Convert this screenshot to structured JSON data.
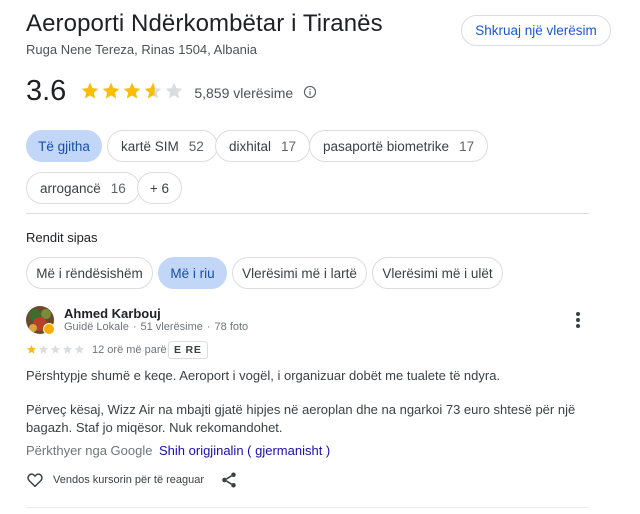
{
  "place": {
    "title": "Aeroporti Ndërkombëtar i Tiranës",
    "address": "Ruga Nene Tereza, Rinas 1504, Albania",
    "write_review_label": "Shkruaj një vlerësim",
    "rating": "3.6",
    "rating_fraction": 0.72,
    "review_count": "5,859 vlerësime"
  },
  "filters": [
    {
      "label": "Të gjitha",
      "count": ""
    },
    {
      "label": "kartë SIM",
      "count": "52"
    },
    {
      "label": "dixhital",
      "count": "17"
    },
    {
      "label": "pasaportë biometrike",
      "count": "17"
    },
    {
      "label": "arrogancë",
      "count": "16"
    },
    {
      "label": "+ 6",
      "count": ""
    }
  ],
  "sort": {
    "label": "Rendit sipas",
    "options": [
      "Më i rëndësishëm",
      "Më i riu",
      "Vlerësimi më i lartë",
      "Vlerësimi më i ulët"
    ],
    "selected": "Më i riu"
  },
  "review": {
    "author": "Ahmed Karbouj",
    "level": "Guidë Lokale",
    "reviews": "51 vlerësime",
    "photos": "78 foto",
    "stars": 1,
    "time": "12 orë më parë",
    "badge": "E RE",
    "paragraph1": "Përshtypje shumë e keqe. Aeroport i vogël, i organizuar dobët me tualete të ndyra.",
    "paragraph2": "Përveç kësaj, Wizz Air na mbajti gjatë hipjes në aeroplan dhe na ngarkoi 73 euro shtesë për një bagazh. Staf jo miqësor. Nuk rekomandohet.",
    "translated_label": "Përkthyer nga Google",
    "see_original": "Shih origjinalin ( gjermanisht )",
    "react_label": "Vendos kursorin për të reaguar"
  },
  "colors": {
    "star_gold": "#fbbc04",
    "star_empty": "#dadce0",
    "active_chip": "#c2d7f8",
    "link": "#1a0dab"
  },
  "icons": [
    "star-icon",
    "info-icon",
    "more-vert-icon",
    "heart-outline-icon",
    "share-icon"
  ]
}
